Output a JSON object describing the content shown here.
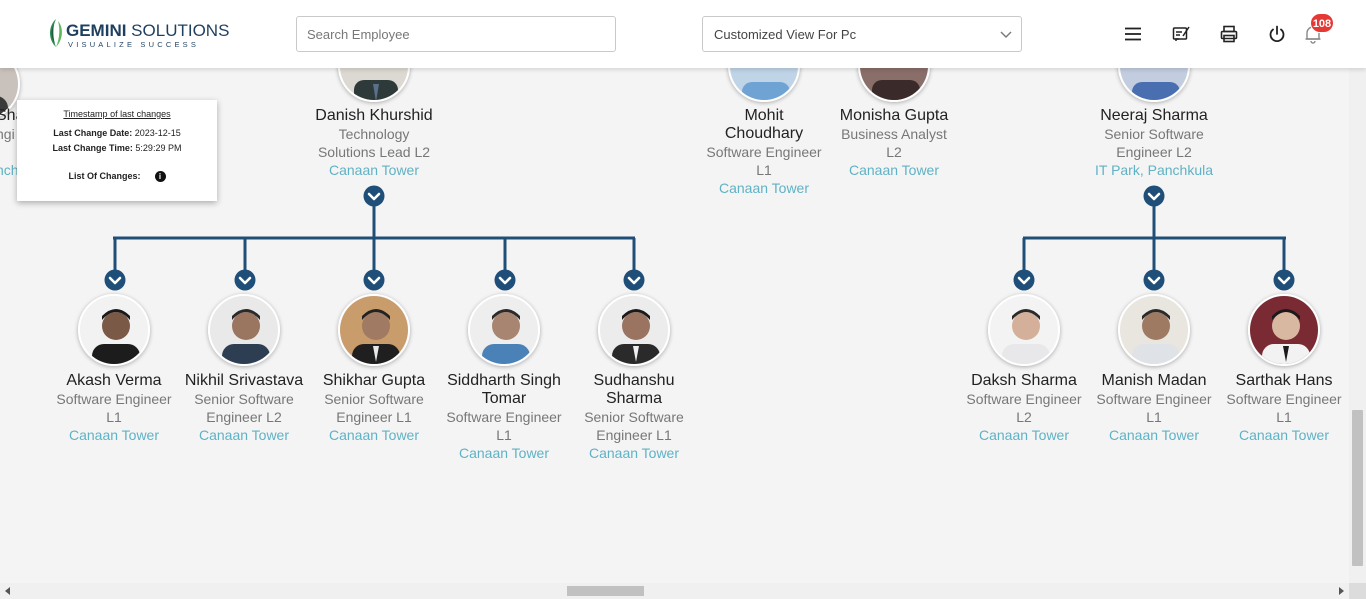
{
  "header": {
    "logo_name_bold": "GEMINI",
    "logo_name_rest": " SOLUTIONS",
    "logo_tagline": "VISUALIZE SUCCESS",
    "search_placeholder": "Search Employee",
    "view_select_value": "Customized View For Pc",
    "notification_count": "108",
    "icons": [
      "menu-icon",
      "feedback-icon",
      "print-icon",
      "power-icon",
      "bell-icon"
    ]
  },
  "popup": {
    "title": "Timestamp of last changes",
    "date_label": "Last Change Date:",
    "date_value": "2023-12-15",
    "time_label": "Last Change Time:",
    "time_value": "5:29:29 PM",
    "changes_label": "List Of Changes:"
  },
  "partial_left": {
    "name_fragment": "Sha",
    "desig_fragment": "ngi",
    "loc_fragment": "nch"
  },
  "top_row": [
    {
      "name": "Danish Khurshid",
      "desig_lines": [
        "Technology",
        "Solutions Lead L2"
      ],
      "location": "Canaan Tower"
    },
    {
      "name_lines": [
        "Mohit",
        "Choudhary"
      ],
      "desig_lines": [
        "Software Engineer",
        "L1"
      ],
      "location": "Canaan Tower"
    },
    {
      "name": "Monisha Gupta",
      "desig_lines": [
        "Business Analyst",
        "L2"
      ],
      "location": "Canaan Tower"
    },
    {
      "name": "Neeraj Sharma",
      "desig_lines": [
        "Senior Software",
        "Engineer L2"
      ],
      "location": "IT Park, Panchkula"
    }
  ],
  "danish_reports": [
    {
      "name_lines": [
        "Akash Verma"
      ],
      "desig_lines": [
        "Software Engineer",
        "L1"
      ],
      "location": "Canaan Tower"
    },
    {
      "name_lines": [
        "Nikhil Srivastava"
      ],
      "desig_lines": [
        "Senior Software",
        "Engineer L2"
      ],
      "location": "Canaan Tower"
    },
    {
      "name_lines": [
        "Shikhar Gupta"
      ],
      "desig_lines": [
        "Senior Software",
        "Engineer L1"
      ],
      "location": "Canaan Tower"
    },
    {
      "name_lines": [
        "Siddharth Singh",
        "Tomar"
      ],
      "desig_lines": [
        "Software Engineer",
        "L1"
      ],
      "location": "Canaan Tower"
    },
    {
      "name_lines": [
        "Sudhanshu",
        "Sharma"
      ],
      "desig_lines": [
        "Senior Software",
        "Engineer L1"
      ],
      "location": "Canaan Tower"
    }
  ],
  "neeraj_reports": [
    {
      "name_lines": [
        "Daksh Sharma"
      ],
      "desig_lines": [
        "Software Engineer",
        "L2"
      ],
      "location": "Canaan Tower"
    },
    {
      "name_lines": [
        "Manish Madan"
      ],
      "desig_lines": [
        "Software Engineer",
        "L1"
      ],
      "location": "Canaan Tower"
    },
    {
      "name_lines": [
        "Sarthak Hans"
      ],
      "desig_lines": [
        "Software Engineer",
        "L1"
      ],
      "location": "Canaan Tower"
    }
  ],
  "colors": {
    "connector": "#1f4e79",
    "location_link": "#5fb2c5",
    "badge": "#e53935"
  }
}
